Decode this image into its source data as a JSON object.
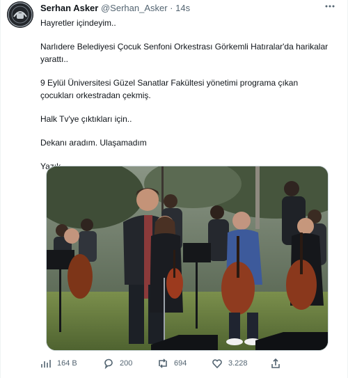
{
  "tweet": {
    "author_name": "Serhan Asker",
    "handle": "@Serhan_Asker",
    "separator": "·",
    "time": "14s",
    "paragraphs": [
      "Hayretler içindeyim..",
      "Narlıdere Belediyesi Çocuk Senfoni Orkestrası  Görkemli Hatıralar'da harikalar yarattı..",
      "9 Eylül Üniversitesi Güzel Sanatlar Fakültesi yönetimi programa çıkan çocukları orkestradan çekmiş.",
      "Halk Tv'ye çıktıkları için..",
      "Dekanı aradım. Ulaşamadım",
      "Yazık"
    ]
  },
  "actions": {
    "views": "164 B",
    "replies": "200",
    "retweets": "694",
    "likes": "3.228"
  },
  "icons": [
    "more-icon",
    "views-icon",
    "reply-icon",
    "retweet-icon",
    "like-icon",
    "share-icon"
  ],
  "colors": {
    "secondary_text": "#536471",
    "primary_text": "#0f1419",
    "border": "#cfd9de"
  }
}
